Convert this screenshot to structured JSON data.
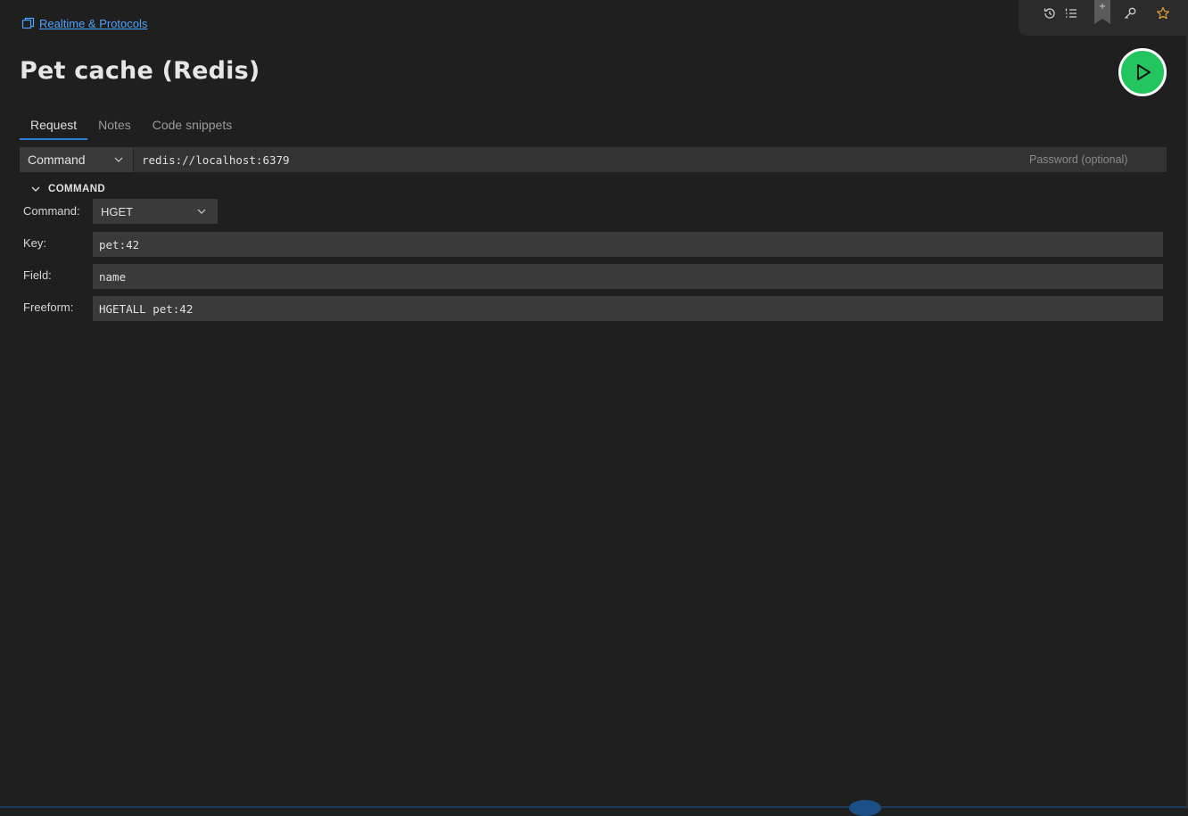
{
  "breadcrumb": {
    "label": "Realtime & Protocols"
  },
  "page": {
    "title": "Pet cache (Redis)"
  },
  "toolbar": {
    "icons": [
      "history-icon",
      "list-icon",
      "bookmark-add-icon",
      "key-icon",
      "star-icon"
    ],
    "bookmark_plus": "+"
  },
  "tabs": [
    {
      "label": "Request",
      "active": true
    },
    {
      "label": "Notes",
      "active": false
    },
    {
      "label": "Code snippets",
      "active": false
    }
  ],
  "connection": {
    "mode": "Command",
    "url": "redis://localhost:6379",
    "password_placeholder": "Password (optional)"
  },
  "command_section": {
    "header": "COMMAND",
    "command_label": "Command:",
    "command_value": "HGET",
    "key_label": "Key:",
    "key_value": "pet:42",
    "field_label": "Field:",
    "field_value": "name",
    "freeform_label": "Freeform:",
    "freeform_value": "HGETALL pet:42"
  },
  "colors": {
    "background": "#1f1f1f",
    "accent": "#2a7ed8",
    "link": "#4aa3ff",
    "run": "#22c55e",
    "star": "#e2a23b"
  }
}
